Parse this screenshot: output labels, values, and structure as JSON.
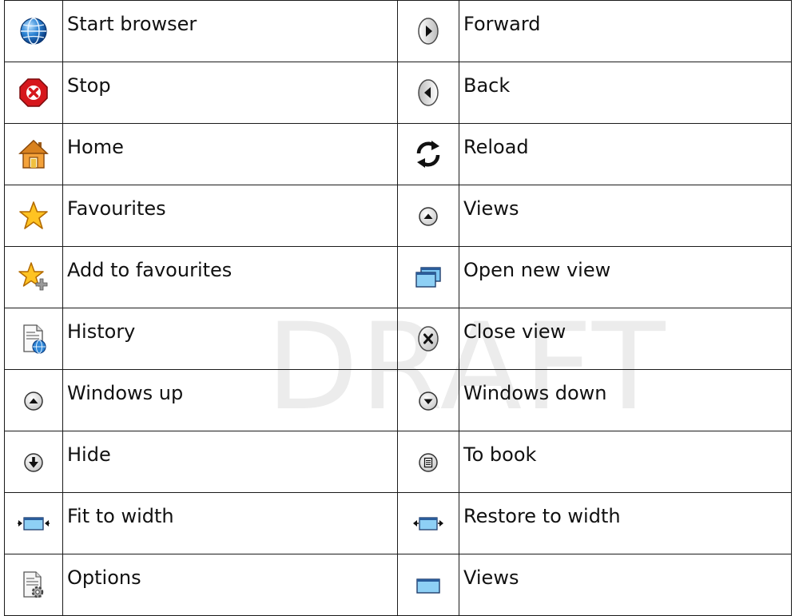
{
  "watermark": "DRAFT",
  "rows": [
    {
      "left": {
        "icon": "globe-icon",
        "label": "Start browser"
      },
      "right": {
        "icon": "forward-arrow-icon",
        "label": "Forward"
      }
    },
    {
      "left": {
        "icon": "stop-icon",
        "label": "Stop"
      },
      "right": {
        "icon": "back-arrow-icon",
        "label": "Back"
      }
    },
    {
      "left": {
        "icon": "home-icon",
        "label": "Home"
      },
      "right": {
        "icon": "reload-icon",
        "label": "Reload"
      }
    },
    {
      "left": {
        "icon": "star-icon",
        "label": "Favourites"
      },
      "right": {
        "icon": "chevron-up-circle-icon",
        "label": "Views"
      }
    },
    {
      "left": {
        "icon": "star-add-icon",
        "label": "Add to favourites"
      },
      "right": {
        "icon": "new-window-icon",
        "label": "Open new view"
      }
    },
    {
      "left": {
        "icon": "history-icon",
        "label": "History"
      },
      "right": {
        "icon": "close-circle-icon",
        "label": "Close view"
      }
    },
    {
      "left": {
        "icon": "chevron-up-circle-icon",
        "label": "Windows up"
      },
      "right": {
        "icon": "chevron-down-circle-icon",
        "label": "Windows down"
      }
    },
    {
      "left": {
        "icon": "arrow-down-circle-icon",
        "label": "Hide"
      },
      "right": {
        "icon": "book-circle-icon",
        "label": "To book"
      }
    },
    {
      "left": {
        "icon": "fit-width-icon",
        "label": "Fit to width"
      },
      "right": {
        "icon": "restore-width-icon",
        "label": "Restore to width"
      }
    },
    {
      "left": {
        "icon": "options-icon",
        "label": "Options"
      },
      "right": {
        "icon": "window-icon",
        "label": "Views"
      }
    }
  ]
}
